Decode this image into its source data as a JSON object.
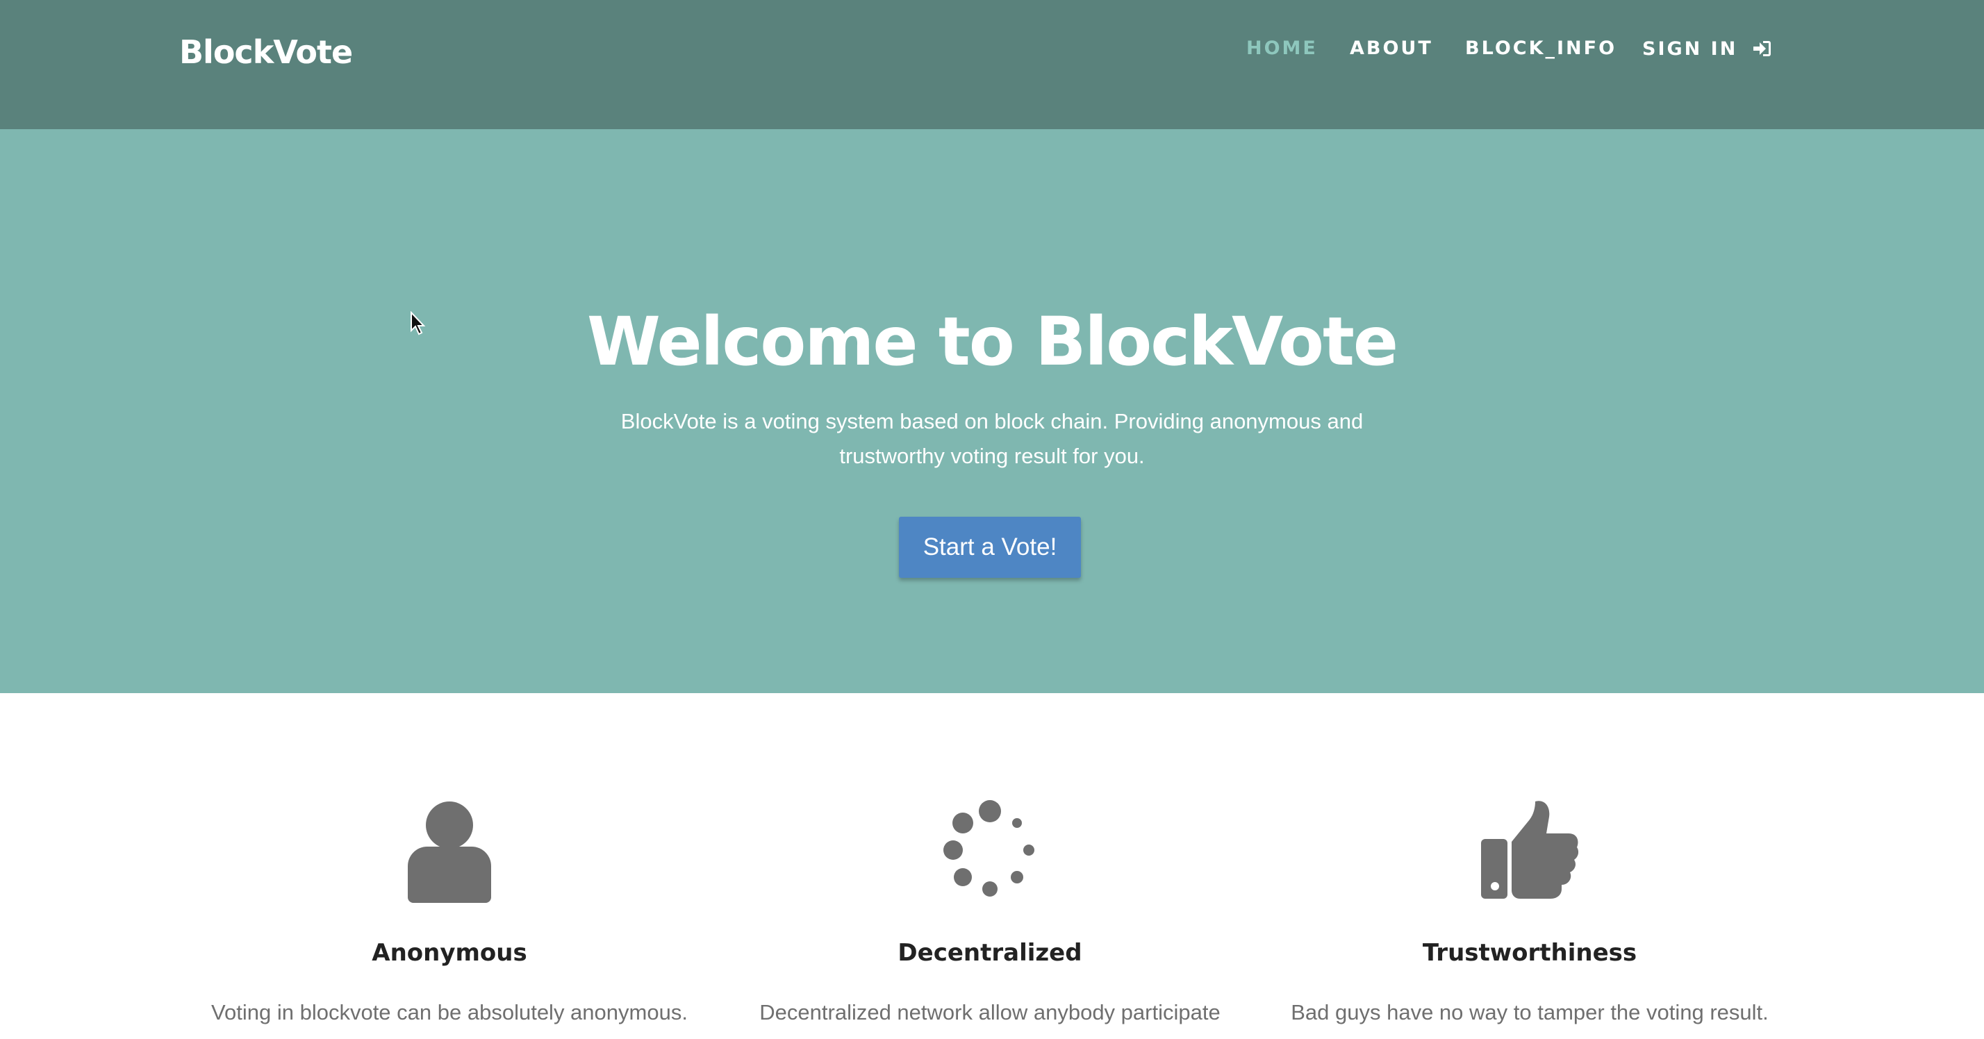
{
  "navbar": {
    "brand": "BlockVote",
    "links": [
      {
        "label": "HOME",
        "active": true
      },
      {
        "label": "ABOUT",
        "active": false
      },
      {
        "label": "BLOCK_INFO",
        "active": false
      },
      {
        "label": "SIGN IN",
        "active": false,
        "icon": "sign-in-icon"
      }
    ]
  },
  "hero": {
    "title": "Welcome to BlockVote",
    "subtitle": "BlockVote is a voting system based on block chain. Providing anonymous and trustworthy voting result for you.",
    "cta_label": "Start a Vote!"
  },
  "features": [
    {
      "icon": "user-icon",
      "title": "Anonymous",
      "description": "Voting in blockvote can be absolutely anonymous."
    },
    {
      "icon": "spinner-icon",
      "title": "Decentralized",
      "description": "Decentralized network allow anybody participate"
    },
    {
      "icon": "thumbs-up-icon",
      "title": "Trustworthiness",
      "description": "Bad guys have no way to tamper the voting result."
    }
  ],
  "colors": {
    "navbar_bg": "#5a827c",
    "hero_bg": "#7fb7b0",
    "active_link": "#8ec7bd",
    "button_bg": "#4e86c4",
    "icon_gray": "#6f6f6f"
  }
}
